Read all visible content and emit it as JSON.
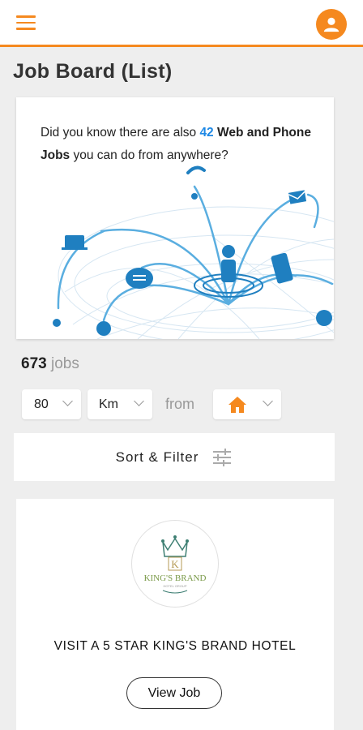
{
  "header": {
    "menu_icon": "hamburger-menu-icon",
    "avatar_icon": "user-icon",
    "accent": "#f5891f"
  },
  "page": {
    "title": "Job Board (List)"
  },
  "promo": {
    "text_before": "Did you know there are also ",
    "count": "42",
    "text_bold": " Web and Phone Jobs",
    "text_after": " you can do from anywhere?",
    "accent": "#1e88e5"
  },
  "results": {
    "count": "673",
    "label": " jobs"
  },
  "filters": {
    "distance_value": "80",
    "unit_value": "Km",
    "from_label": "from",
    "home_icon": "home-icon"
  },
  "sort": {
    "label": "Sort & Filter",
    "icon": "sliders-icon"
  },
  "job": {
    "logo_text": "KING'S BRAND",
    "logo_subtext": "HOTEL GROUP",
    "logo_letter": "K",
    "title": "VISIT A 5 STAR KING'S BRAND HOTEL",
    "view_label": "View Job"
  }
}
